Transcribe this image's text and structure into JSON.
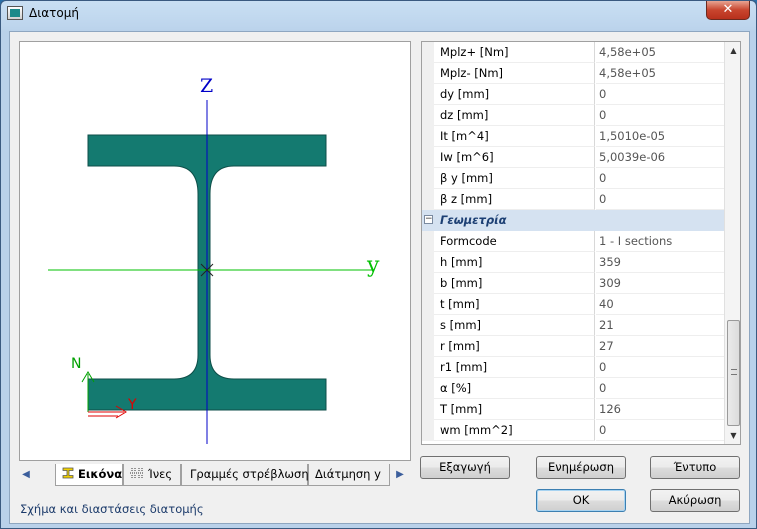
{
  "window": {
    "title": "Διατομή",
    "close_label": "✕"
  },
  "drawing": {
    "axis_z_label": "Z",
    "axis_y_label": "y",
    "local_n_label": "N",
    "local_y_label": "Y",
    "section_color": "#147a70",
    "axis_color": "#0000c8",
    "horizontal_axis_color": "#00c000"
  },
  "tabs": [
    {
      "label": "Εικόνα",
      "icon": "i-beam-icon",
      "active": true
    },
    {
      "label": "Ίνες",
      "icon": "fibers-icon",
      "active": false
    },
    {
      "label": "Γραμμές στρέβλωσης",
      "icon": "",
      "active": false
    },
    {
      "label": "Διάτμηση y",
      "icon": "",
      "active": false
    }
  ],
  "status_text": "Σχήμα και διαστάσεις διατομής",
  "properties_top": [
    {
      "name": "Mplz+ [Nm]",
      "value": "4,58e+05"
    },
    {
      "name": "Mplz- [Nm]",
      "value": "4,58e+05"
    },
    {
      "name": "dy [mm]",
      "value": "0"
    },
    {
      "name": "dz [mm]",
      "value": "0"
    },
    {
      "name": "It [m^4]",
      "value": "1,5010e-05"
    },
    {
      "name": "Iw [m^6]",
      "value": "5,0039e-06"
    },
    {
      "name": "β y [mm]",
      "value": "0"
    },
    {
      "name": "β z [mm]",
      "value": "0"
    }
  ],
  "category": {
    "label": "Γεωμετρία",
    "toggle": "−"
  },
  "properties_geometry": [
    {
      "name": "Formcode",
      "value": "1 - I sections"
    },
    {
      "name": "h [mm]",
      "value": "359"
    },
    {
      "name": "b [mm]",
      "value": "309"
    },
    {
      "name": "t [mm]",
      "value": "40"
    },
    {
      "name": "s [mm]",
      "value": "21"
    },
    {
      "name": "r [mm]",
      "value": "27"
    },
    {
      "name": "r1 [mm]",
      "value": "0"
    },
    {
      "name": "α [%]",
      "value": "0"
    },
    {
      "name": "T [mm]",
      "value": "126"
    },
    {
      "name": "wm [mm^2]",
      "value": "0"
    }
  ],
  "buttons": {
    "export": "Εξαγωγή",
    "update": "Ενημέρωση",
    "print": "Έντυπο",
    "ok": "OK",
    "cancel": "Ακύρωση"
  }
}
